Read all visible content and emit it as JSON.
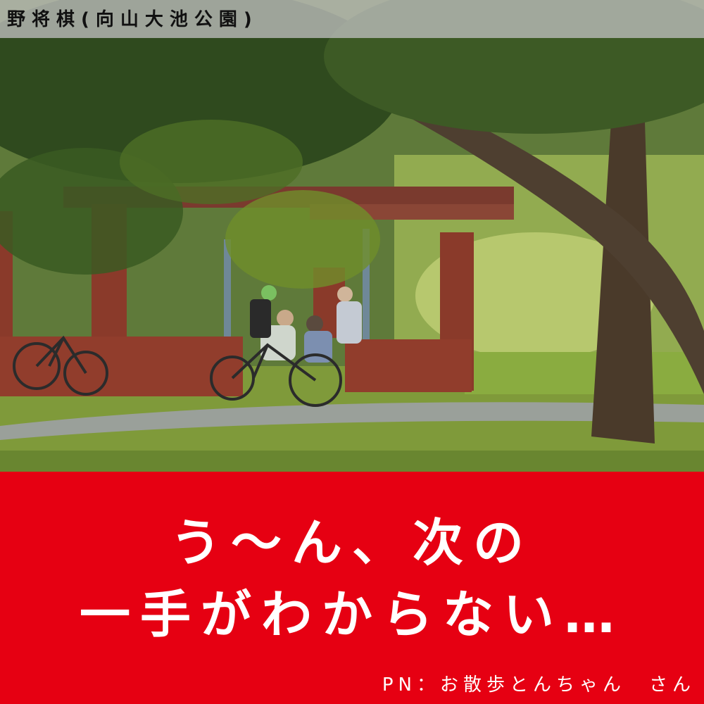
{
  "caption": "野将棋(向山大池公園)",
  "headline": {
    "line1": "う～ん、次の",
    "line2": "一手がわからない…"
  },
  "credit": "PN：お散歩とんちゃん　さん",
  "colors": {
    "panel": "#e60012",
    "headline_text": "#ffffff",
    "caption_bar": "#bebebe"
  }
}
